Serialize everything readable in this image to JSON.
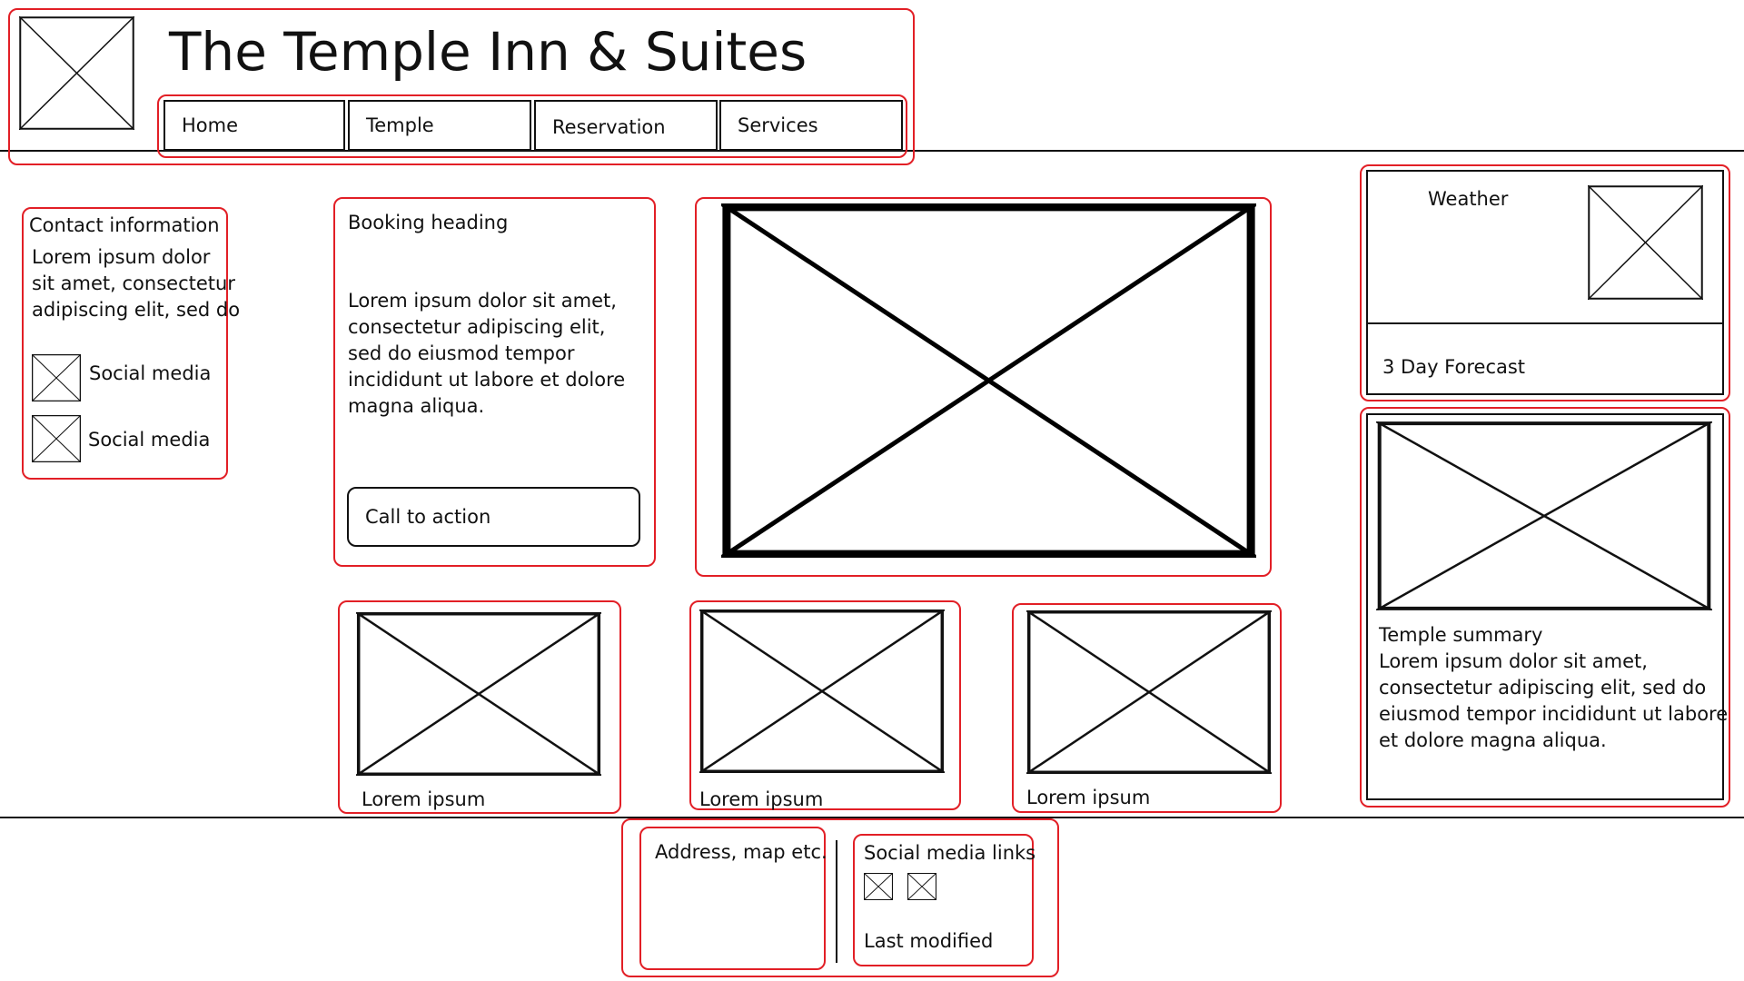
{
  "header": {
    "title": "The Temple Inn & Suites",
    "logo_icon": "image-placeholder-icon",
    "nav": [
      {
        "label": "Home"
      },
      {
        "label": "Temple"
      },
      {
        "label": "Reservation"
      },
      {
        "label": "Services"
      }
    ]
  },
  "contact": {
    "heading": "Contact information",
    "lines": [
      "Lorem ipsum dolor",
      "sit amet, consectetur",
      "adipiscing elit, sed do"
    ],
    "social": [
      {
        "label": "Social media",
        "icon": "image-placeholder-icon"
      },
      {
        "label": "Social media",
        "icon": "image-placeholder-icon"
      }
    ]
  },
  "booking": {
    "heading": "Booking heading",
    "lines": [
      "Lorem ipsum dolor sit amet,",
      "consectetur adipiscing elit,",
      "sed do eiusmod tempor",
      "incididunt ut labore et dolore",
      "magna aliqua."
    ],
    "cta_label": "Call to action"
  },
  "hero": {
    "icon": "image-placeholder-icon"
  },
  "weather": {
    "heading": "Weather",
    "forecast_label": "3 Day Forecast",
    "icon": "image-placeholder-icon"
  },
  "temple_summary": {
    "heading": "Temple summary",
    "lines": [
      "Lorem ipsum dolor sit amet,",
      "consectetur adipiscing elit, sed do",
      "eiusmod tempor incididunt ut labore",
      "et dolore magna aliqua."
    ]
  },
  "cards": [
    {
      "caption": "Lorem ipsum"
    },
    {
      "caption": "Lorem ipsum"
    },
    {
      "caption": "Lorem ipsum"
    }
  ],
  "footer": {
    "address_label": "Address, map etc.",
    "social_heading": "Social media links",
    "last_modified_label": "Last modified"
  },
  "colors": {
    "annotation_red": "#e21f26",
    "line": "#111111",
    "background": "#ffffff"
  }
}
